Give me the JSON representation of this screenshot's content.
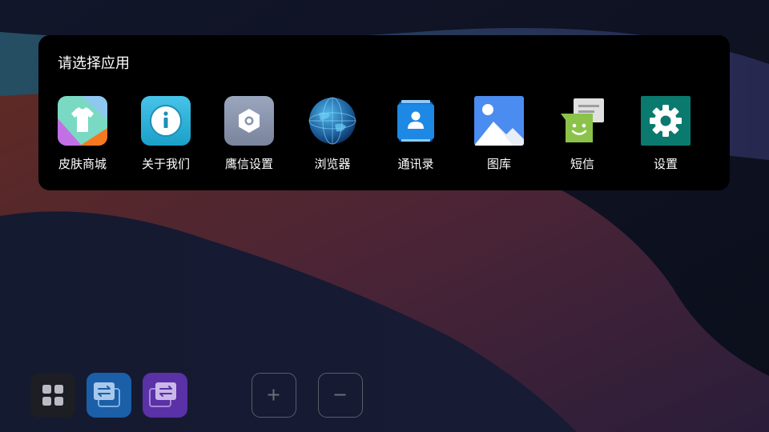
{
  "picker": {
    "title": "请选择应用",
    "apps": [
      {
        "label": "皮肤商城",
        "icon": "skin-store-shirt-icon"
      },
      {
        "label": "关于我们",
        "icon": "info-icon"
      },
      {
        "label": "鹰信设置",
        "icon": "hexagon-settings-icon"
      },
      {
        "label": "浏览器",
        "icon": "globe-browser-icon"
      },
      {
        "label": "通讯录",
        "icon": "contacts-icon"
      },
      {
        "label": "图库",
        "icon": "gallery-icon"
      },
      {
        "label": "短信",
        "icon": "messaging-icon"
      },
      {
        "label": "设置",
        "icon": "gear-icon"
      }
    ]
  },
  "dock": {
    "buttons": [
      {
        "name": "apps-grid-button",
        "icon": "grid-icon"
      },
      {
        "name": "switch-window-button",
        "icon": "swap-arrows-icon"
      },
      {
        "name": "swap-window-button",
        "icon": "swap-arrows-icon"
      },
      {
        "name": "add-button",
        "icon": "plus-icon"
      },
      {
        "name": "remove-button",
        "icon": "minus-icon"
      }
    ]
  },
  "colors": {
    "background": "#0d1120",
    "panel": "#000000",
    "dock_blue": "#1b5fa8",
    "dock_purple": "#5a31a6",
    "settings_teal": "#0b7a6e"
  }
}
